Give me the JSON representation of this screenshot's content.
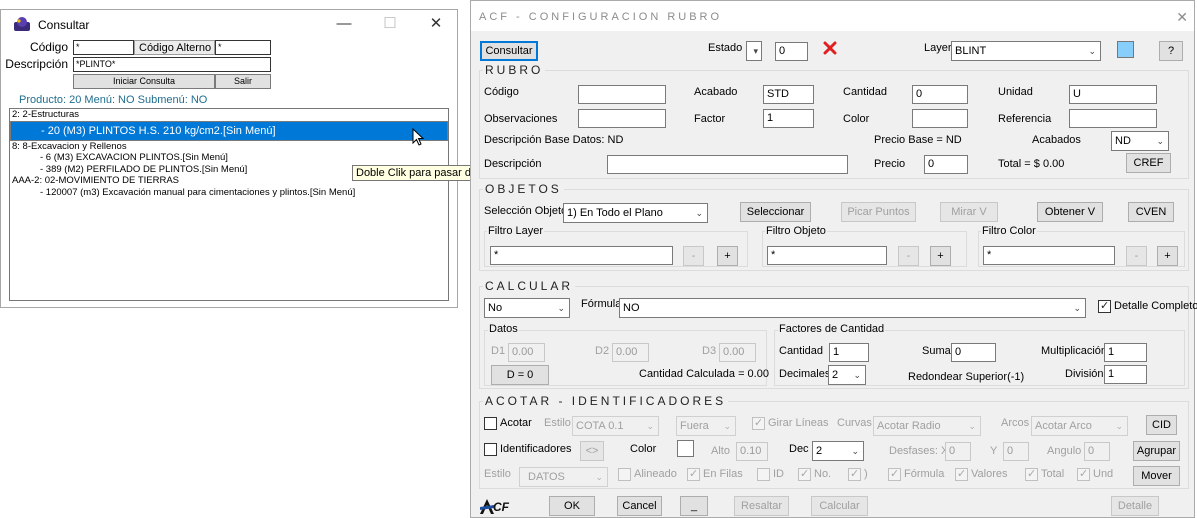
{
  "consultar": {
    "title": "Consultar",
    "codigo_label": "Código",
    "codigo_value": "*",
    "codigo_alterno_label": "Código Alterno",
    "codigo_alterno_value": "*",
    "descripcion_label": "Descripción",
    "descripcion_value": "*PLINTO*",
    "iniciar_label": "Iniciar Consulta",
    "salir_label": "Salir",
    "status": "Producto: 20 Menú: NO Submenú: NO",
    "items": [
      "2: 2-Estructuras",
      "- 20 (M3) PLINTOS H.S. 210 kg/cm2.[Sin Menú]",
      "8: 8-Excavacion y Rellenos",
      "- 6 (M3) EXCAVACION PLINTOS.[Sin Menú]",
      "- 389 (M2) PERFILADO DE PLINTOS.[Sin Menú]",
      "AAA-2: 02-MOVIMIENTO DE TIERRAS",
      "- 120007 (m3) Excavación manual para cimentaciones y plintos.[Sin Menú]"
    ],
    "tooltip": "Doble Clik para pasar dato."
  },
  "acf": {
    "title": "ACF - CONFIGURACION RUBRO",
    "top": {
      "consultar_label": "Consultar",
      "estado_label": "Estado",
      "estado_value": "0",
      "layer_label": "Layer",
      "layer_value": "BLINT",
      "help_label": "?"
    },
    "rubro": {
      "title": "RUBRO",
      "codigo_label": "Código",
      "acabado_label": "Acabado",
      "acabado_value": "STD",
      "cantidad_label": "Cantidad",
      "cantidad_value": "0",
      "unidad_label": "Unidad",
      "unidad_value": "U",
      "observaciones_label": "Observaciones",
      "factor_label": "Factor",
      "factor_value": "1",
      "color_label": "Color",
      "referencia_label": "Referencia",
      "desc_base_label": "Descripción Base Datos: ND",
      "precio_base_label": "Precio Base = ND",
      "acabados_label": "Acabados",
      "acabados_value": "ND",
      "descripcion_label": "Descripción",
      "precio_label": "Precio",
      "precio_value": "0",
      "total_label": "Total = $ 0.00",
      "cref_label": "CREF"
    },
    "objetos": {
      "title": "OBJETOS",
      "seleccion_label": "Selección Objetos",
      "seleccion_value": "1) En Todo el Plano",
      "seleccionar_label": "Seleccionar",
      "picar_label": "Picar Puntos",
      "mirar_label": "Mirar V",
      "obtener_label": "Obtener V",
      "cven_label": "CVEN",
      "filtro_layer_label": "Filtro Layer",
      "filtro_layer_value": "*",
      "filtro_objeto_label": "Filtro Objeto",
      "filtro_objeto_value": "*",
      "filtro_color_label": "Filtro Color",
      "filtro_color_value": "*",
      "minus": "-",
      "plus": "+"
    },
    "calcular": {
      "title": "CALCULAR",
      "no_value": "No",
      "formula_label": "Fórmula",
      "formula_value": "NO",
      "detalle_label": "Detalle Completo",
      "datos_label": "Datos",
      "d1_label": "D1",
      "d1_value": "0.00",
      "d2_label": "D2",
      "d2_value": "0.00",
      "d3_label": "D3",
      "d3_value": "0.00",
      "d0_label": "D = 0",
      "cantidad_calc_label": "Cantidad Calculada = 0.00",
      "factores_label": "Factores de Cantidad",
      "cantidad_label": "Cantidad",
      "cantidad_value": "1",
      "suma_label": "Suma",
      "suma_value": "0",
      "multiplicacion_label": "Multiplicación",
      "multiplicacion_value": "1",
      "decimales_label": "Decimales",
      "decimales_value": "2",
      "redondear_label": "Redondear Superior(-1)",
      "division_label": "División",
      "division_value": "1"
    },
    "acotar": {
      "title": "ACOTAR - IDENTIFICADORES",
      "acotar_label": "Acotar",
      "estilo_label": "Estilo",
      "estilo_value": "COTA 0.1",
      "fuera_value": "Fuera",
      "girar_label": "Girar Líneas",
      "curvas_label": "Curvas",
      "curvas_value": "Acotar Radio",
      "arcos_label": "Arcos",
      "arcos_value": "Acotar Arco",
      "cid_label": "CID",
      "identificadores_label": "Identificadores",
      "swap_label": "<>",
      "color_label": "Color",
      "alto_label": "Alto",
      "alto_value": "0.10",
      "dec_label": "Dec",
      "dec_value": "2",
      "desfases_label": "Desfases: X",
      "desfases_x_value": "0",
      "y_label": "Y",
      "y_value": "0",
      "angulo_label": "Angulo",
      "angulo_value": "0",
      "agrupar_label": "Agrupar",
      "estilo2_label": "Estilo",
      "datos_value": "DATOS",
      "alineado_label": "Alineado",
      "en_filas_label": "En Filas",
      "id_label": "ID",
      "no_label": "No.",
      "paren_label": ")",
      "formula_label": "Fórmula",
      "valores_label": "Valores",
      "total_label": "Total",
      "und_label": "Und",
      "mover_label": "Mover"
    },
    "bottom": {
      "logo_text": "CF",
      "ok_label": "OK",
      "cancel_label": "Cancel",
      "underscore_label": "_",
      "resaltar_label": "Resaltar",
      "calcular_label": "Calcular",
      "detalle_label": "Detalle"
    },
    "colors": {
      "layer_swatch": "#87cefa",
      "delete_x": "#e02020",
      "selection": "#0078d7",
      "status_text": "#1f6e8e"
    }
  }
}
